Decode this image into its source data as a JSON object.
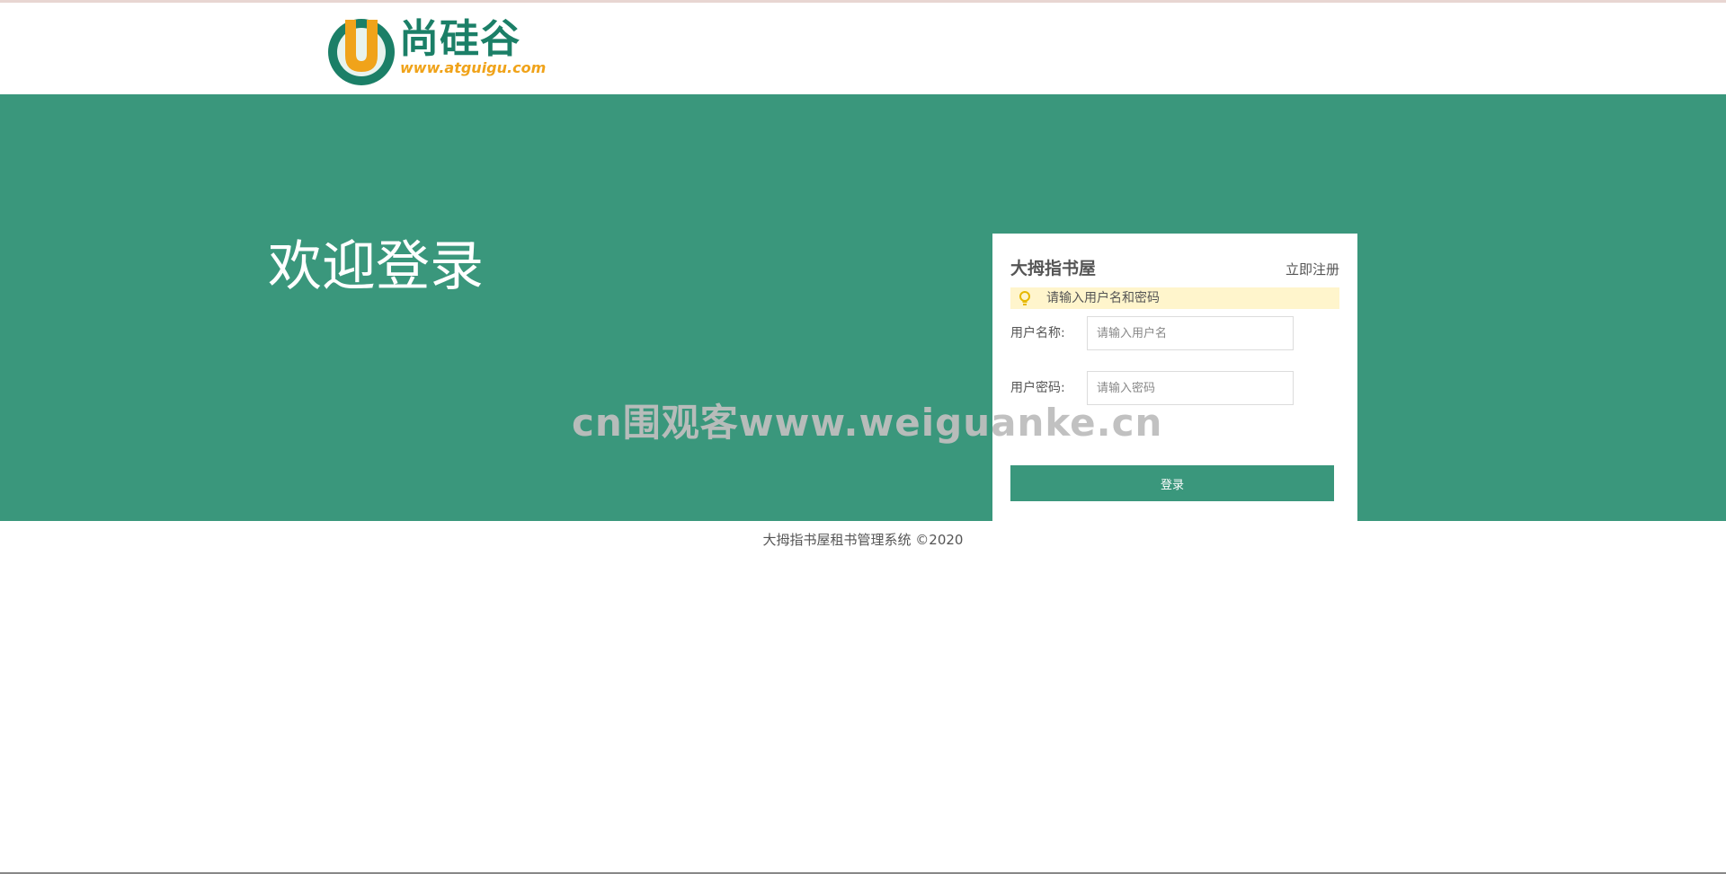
{
  "header": {
    "logo_text": "尚硅谷",
    "logo_url": "www.atguigu.com"
  },
  "banner": {
    "welcome_text": "欢迎登录",
    "background_color": "#3a977c"
  },
  "watermark": {
    "text": "cn围观客www.weiguanke.cn"
  },
  "login_box": {
    "title": "大拇指书屋",
    "register_link": "立即注册",
    "tip": "请输入用户名和密码",
    "tip_icon": "lightbulb-icon",
    "username": {
      "label": "用户名称:",
      "placeholder": "请输入用户名",
      "value": ""
    },
    "password": {
      "label": "用户密码:",
      "placeholder": "请输入密码",
      "value": ""
    },
    "submit_label": "登录"
  },
  "footer": {
    "text": "大拇指书屋租书管理系统 ©2020"
  }
}
